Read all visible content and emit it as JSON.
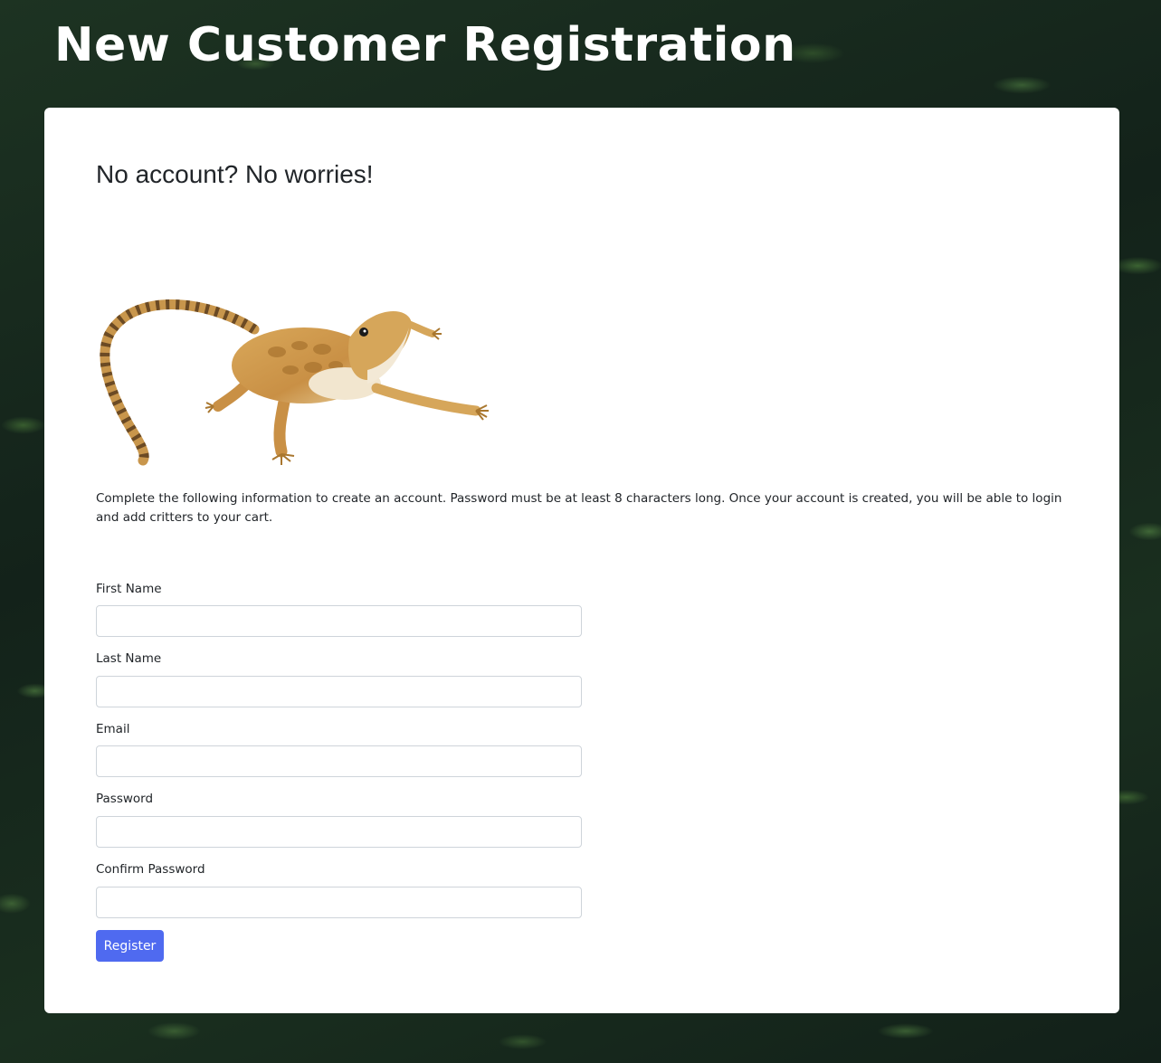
{
  "header": {
    "title": "New Customer Registration"
  },
  "card": {
    "heading": "No account? No worries!",
    "image_alt": "bearded dragon lizard",
    "intro": "Complete the following information to create an account. Password must be at least 8 characters long. Once your account is created, you will be able to login and add critters to your cart."
  },
  "form": {
    "first_name": {
      "label": "First Name",
      "value": "",
      "placeholder": ""
    },
    "last_name": {
      "label": "Last Name",
      "value": "",
      "placeholder": ""
    },
    "email": {
      "label": "Email",
      "value": "",
      "placeholder": ""
    },
    "password": {
      "label": "Password",
      "value": "",
      "placeholder": ""
    },
    "confirm_password": {
      "label": "Confirm Password",
      "value": "",
      "placeholder": ""
    },
    "submit_label": "Register"
  },
  "colors": {
    "accent": "#4f6af0",
    "card_background": "#ffffff",
    "title_text": "#ffffff"
  }
}
